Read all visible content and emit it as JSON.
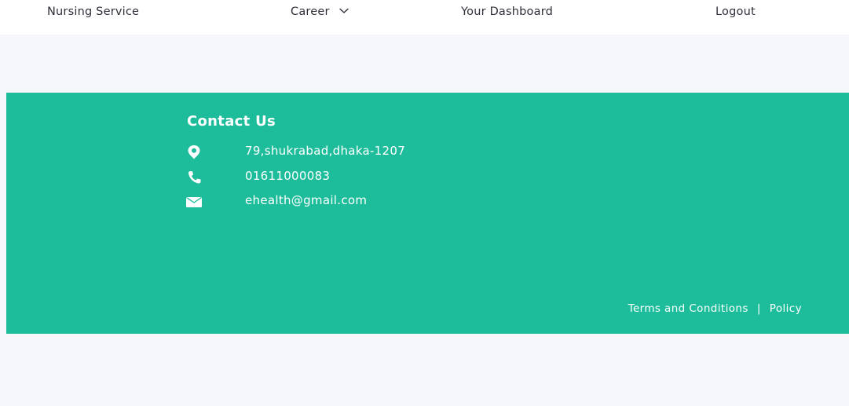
{
  "nav": {
    "items": [
      {
        "label": "Nursing Service"
      },
      {
        "label": "Career"
      },
      {
        "label": "Your Dashboard"
      },
      {
        "label": "Logout"
      }
    ]
  },
  "footer": {
    "contact_title": "Contact Us",
    "address": "79,shukrabad,dhaka-1207",
    "phone": "01611000083",
    "email": "ehealth@gmail.com",
    "terms_label": "Terms and Conditions",
    "separator": "|",
    "policy_label": "Policy"
  },
  "colors": {
    "footer_bg": "#1dbd9c",
    "page_bg": "#f5f7fa",
    "nav_text": "#2f2f3a"
  },
  "icons": {
    "address": "map-pin-icon",
    "phone": "phone-icon",
    "email": "envelope-icon",
    "career_dropdown": "chevron-down-icon"
  }
}
